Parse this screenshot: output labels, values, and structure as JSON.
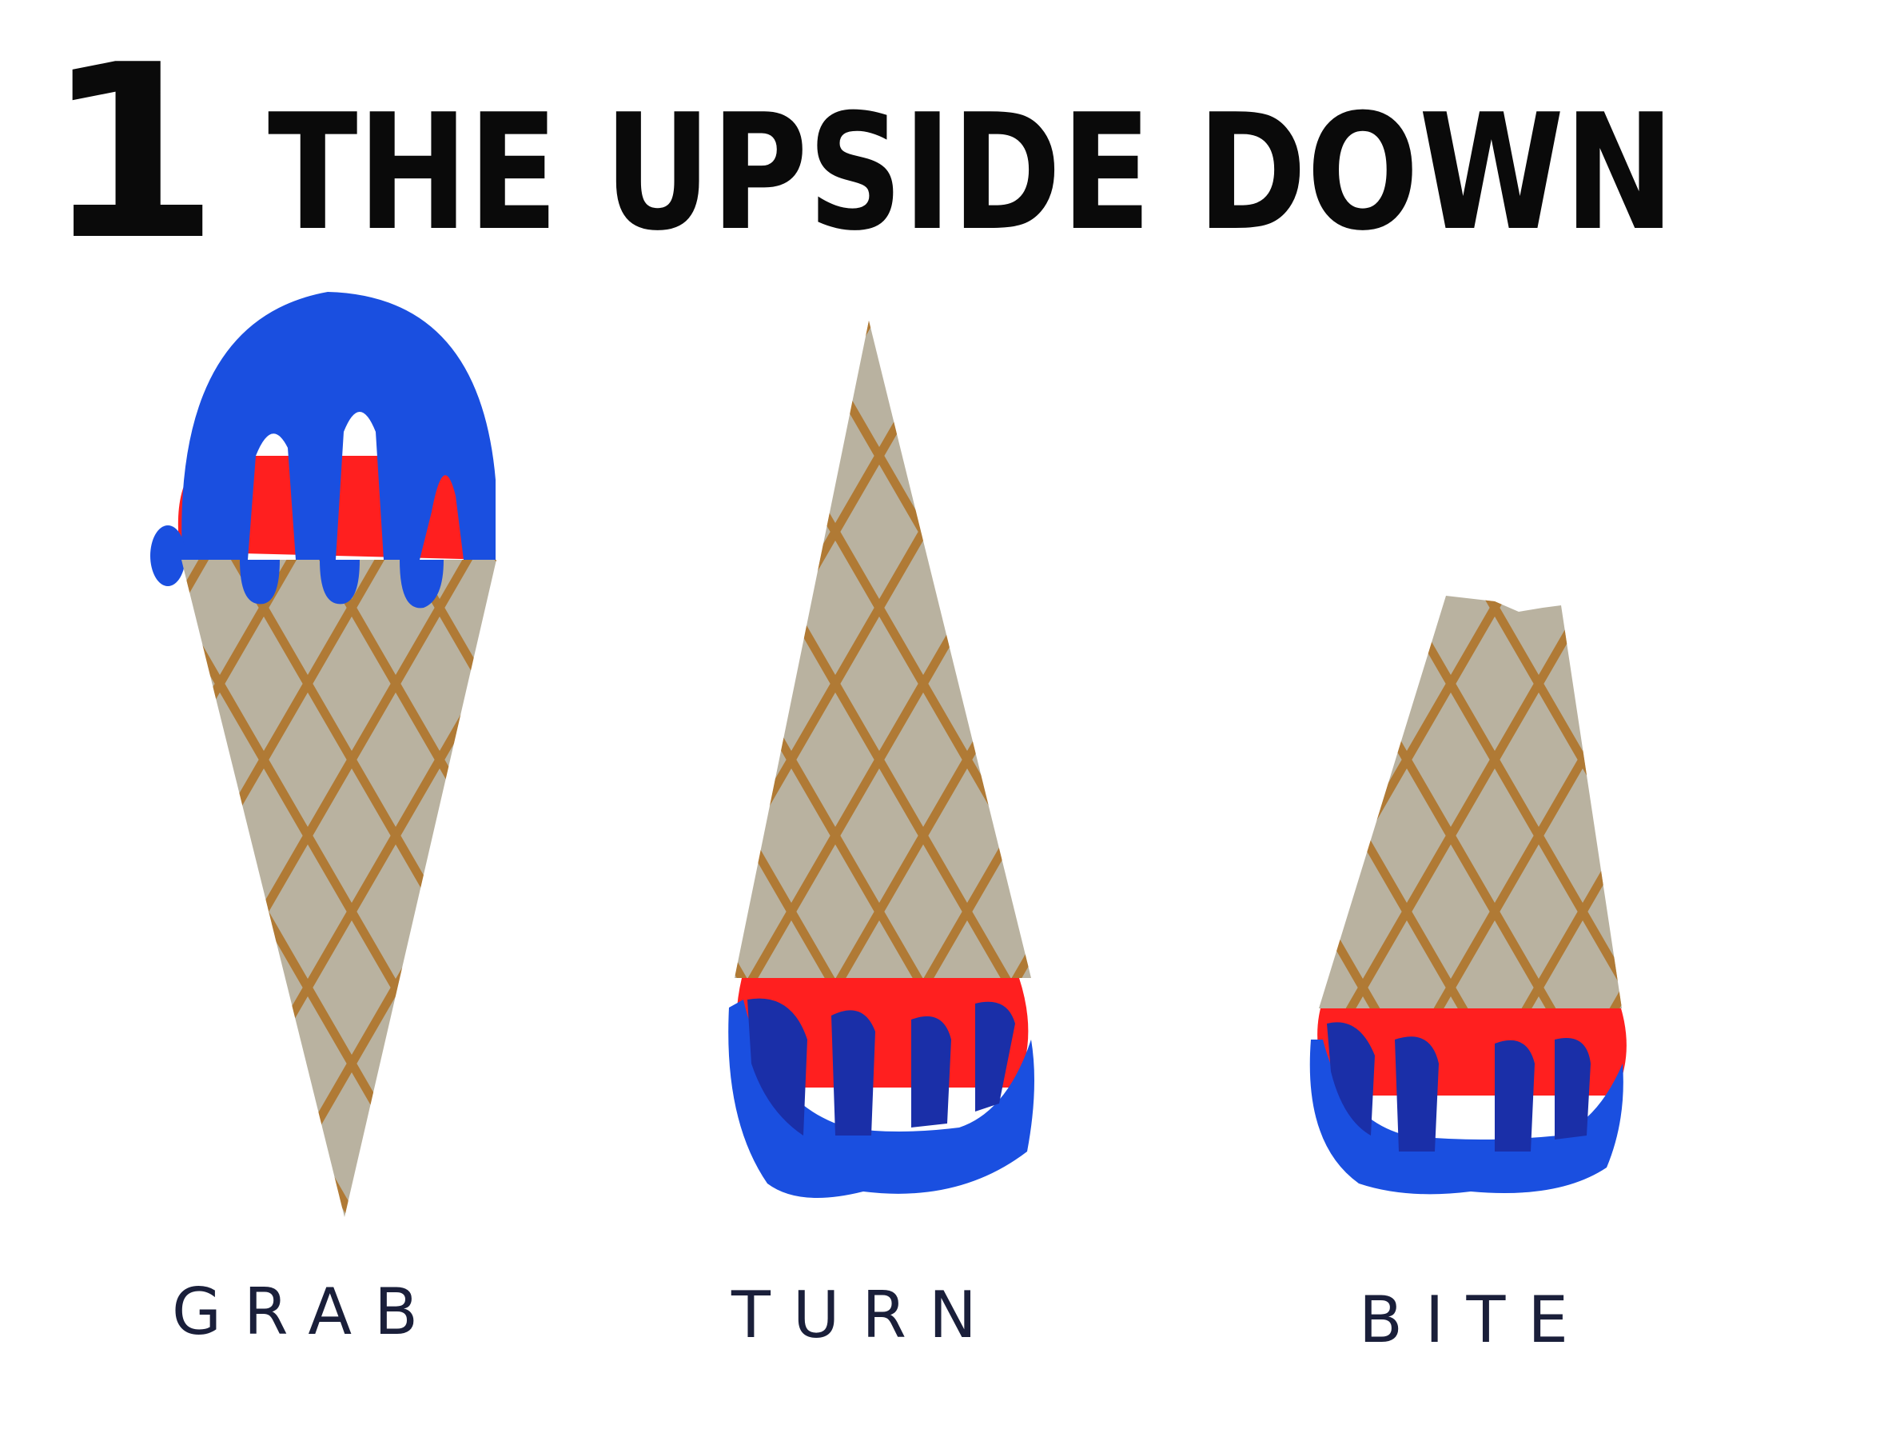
{
  "title": {
    "number": "1",
    "text": "THE UPSIDE DOWN"
  },
  "steps": [
    {
      "label": "GRAB"
    },
    {
      "label": "TURN"
    },
    {
      "label": "BITE"
    }
  ],
  "colors": {
    "cone": "#b9b2a0",
    "lattice": "#b07a35",
    "ice_cream_blue": "#1a4fe0",
    "drip_dark_blue": "#1a2fa8",
    "ice_cream_red": "#ff1f1f",
    "ink": "#0a0a0a"
  }
}
